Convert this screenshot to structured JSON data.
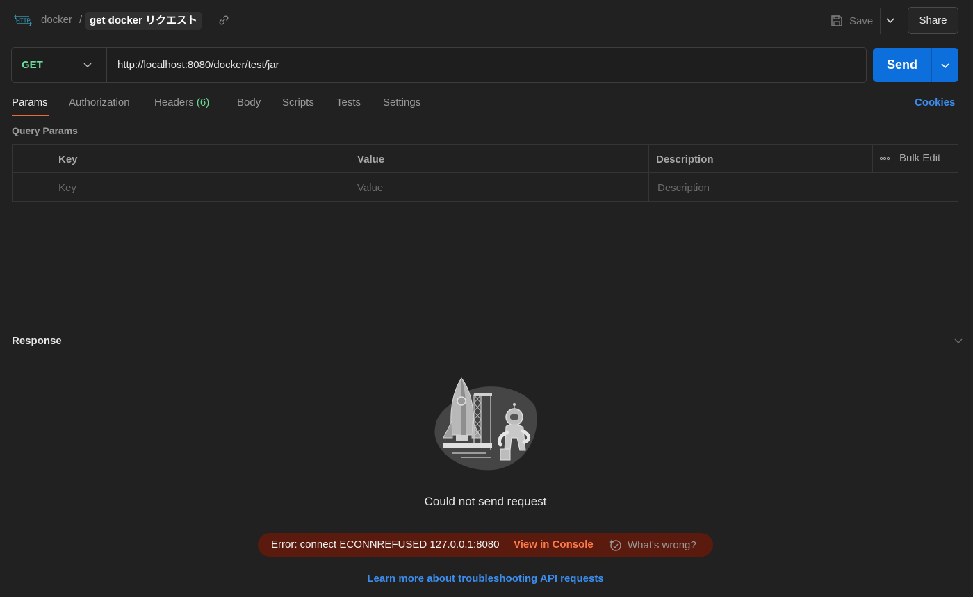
{
  "header": {
    "icon_label": "HTTP",
    "breadcrumb_parent": "docker",
    "breadcrumb_separator": "/",
    "request_name": "get docker リクエスト",
    "save_label": "Save",
    "share_label": "Share"
  },
  "request": {
    "method": "GET",
    "url": "http://localhost:8080/docker/test/jar",
    "send_label": "Send"
  },
  "tabs": {
    "params": "Params",
    "authorization": "Authorization",
    "headers": "Headers",
    "headers_count": "(6)",
    "body": "Body",
    "scripts": "Scripts",
    "tests": "Tests",
    "settings": "Settings",
    "cookies": "Cookies"
  },
  "query_params": {
    "title": "Query Params",
    "columns": {
      "key": "Key",
      "value": "Value",
      "description": "Description"
    },
    "bulk_edit": "Bulk Edit",
    "placeholders": {
      "key": "Key",
      "value": "Value",
      "description": "Description"
    }
  },
  "response": {
    "title": "Response",
    "message": "Could not send request",
    "error_text": "Error: connect ECONNREFUSED 127.0.0.1:8080",
    "view_console": "View in Console",
    "whats_wrong": "What's wrong?",
    "learn_more": "Learn more about troubleshooting API requests"
  },
  "colors": {
    "background": "#212121",
    "method_get": "#6bdd9a",
    "send": "#0c6fdb",
    "tab_active_underline": "#e8693c",
    "link": "#3b8ef0",
    "error_bg": "#5a1a0e",
    "error_accent": "#ff7a4a"
  },
  "icons": [
    "http-icon",
    "link-icon",
    "save-icon",
    "chevron-down-icon",
    "more-dots-icon",
    "sparkle-icon"
  ]
}
